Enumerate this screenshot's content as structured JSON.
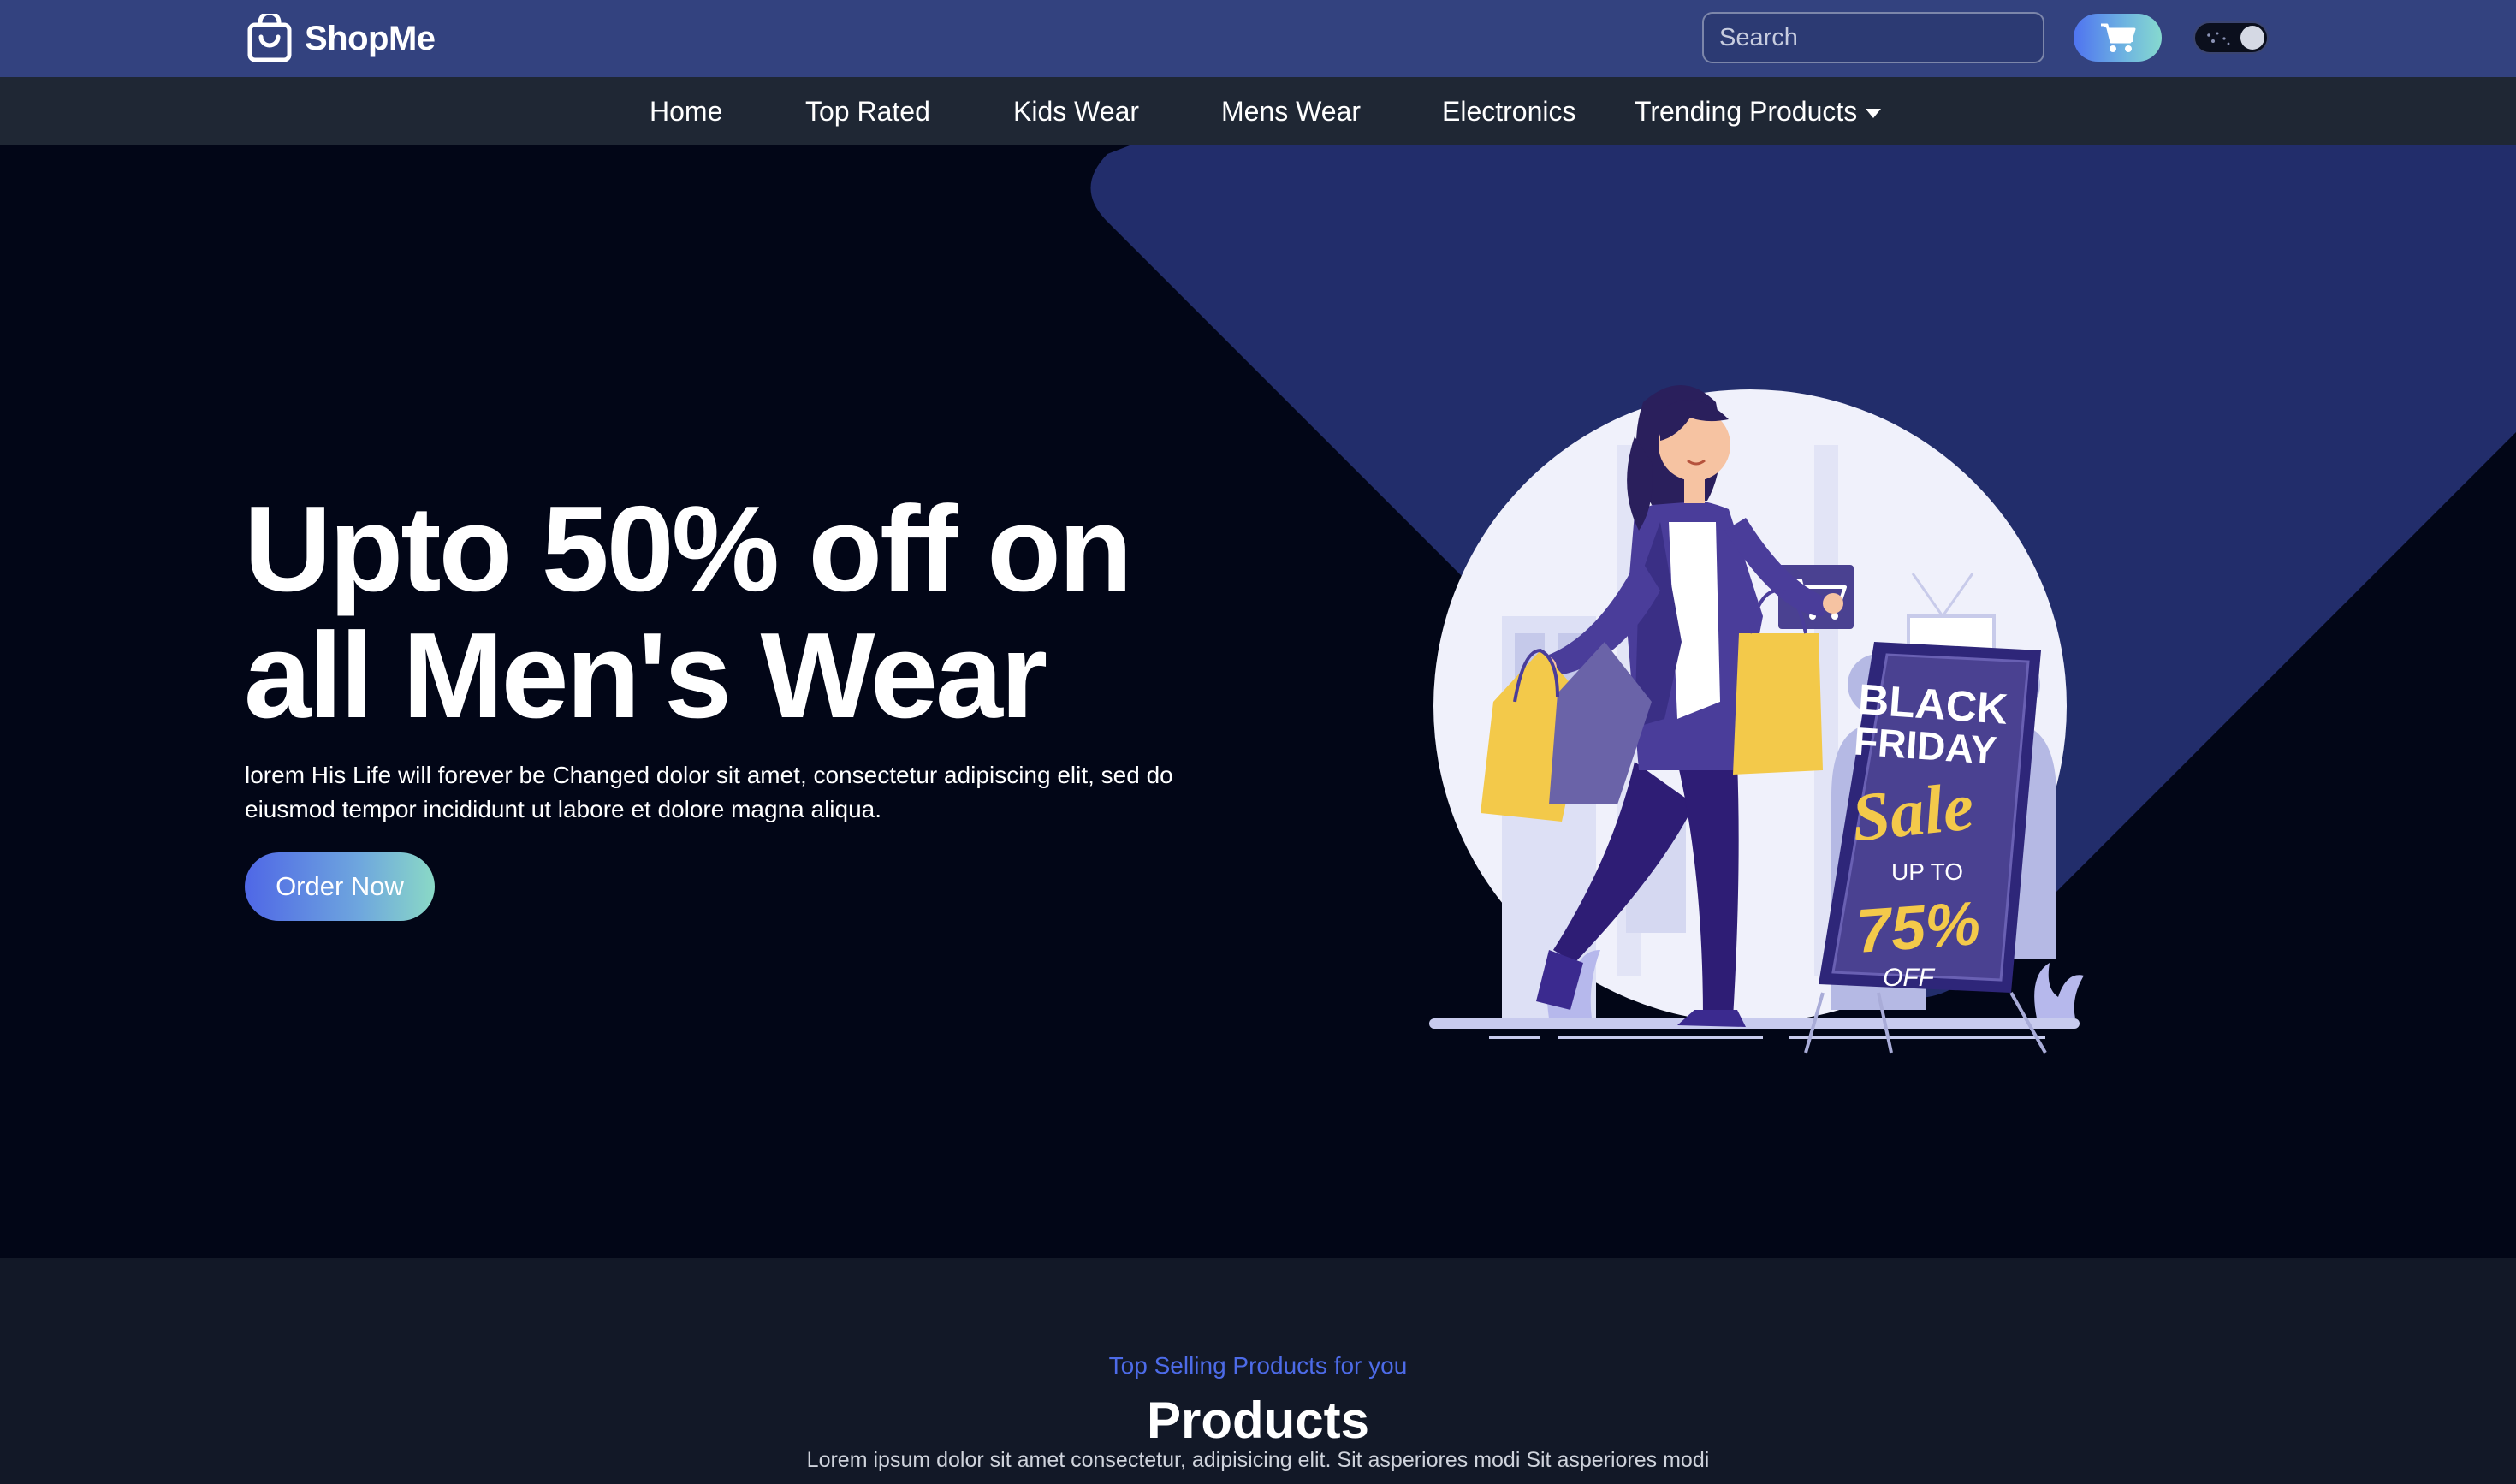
{
  "header": {
    "brand": "ShopMe",
    "search_placeholder": "Search"
  },
  "nav": {
    "items": [
      {
        "label": "Home"
      },
      {
        "label": "Top Rated"
      },
      {
        "label": "Kids Wear"
      },
      {
        "label": "Mens Wear"
      },
      {
        "label": "Electronics"
      },
      {
        "label": "Trending Products"
      }
    ]
  },
  "hero": {
    "title_line1": "Upto 50% off on",
    "title_line2": "all Men's Wear",
    "description": "lorem His Life will forever be Changed dolor sit amet, consectetur adipiscing elit, sed do eiusmod tempor incididunt ut labore et dolore magna aliqua.",
    "button_label": "Order Now",
    "sign_line1": "BLACK",
    "sign_line2": "FRIDAY",
    "sign_sale": "Sale",
    "sign_upto": "UP TO",
    "sign_percent": "75%",
    "sign_off": "OFF"
  },
  "products": {
    "subtitle": "Top Selling Products for you",
    "title": "Products",
    "description": "Lorem ipsum dolor sit amet consectetur, adipisicing elit. Sit asperiores modi Sit asperiores modi"
  },
  "icons": {
    "logo": "shopping-bag-icon",
    "cart": "cart-icon",
    "theme": "theme-toggle-icon",
    "dropdown": "caret-down-icon"
  },
  "colors": {
    "header_bg": "#33427f",
    "nav_bg": "#1f2734",
    "hero_bg": "#020617",
    "hero_shape": "#222d6b",
    "accent_blue": "#4d6be8",
    "accent_teal": "#8ad9c6",
    "products_bg": "#121827"
  }
}
